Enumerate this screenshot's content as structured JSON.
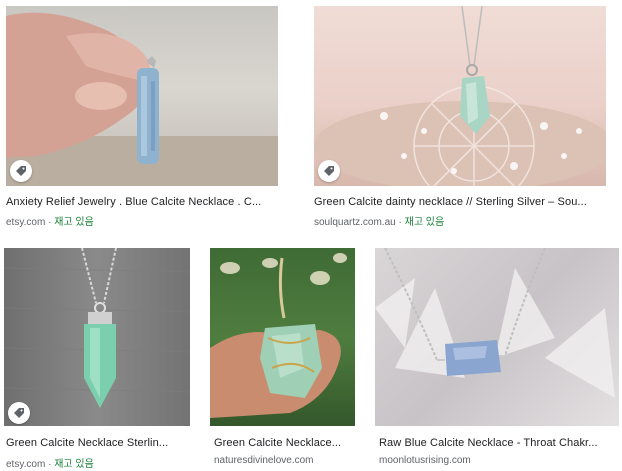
{
  "results": [
    {
      "title": "Anxiety Relief Jewelry . Blue Calcite Necklace . C...",
      "source": "etsy.com",
      "stock": "재고 있음",
      "has_tag": true
    },
    {
      "title": "Green Calcite dainty necklace // Sterling Silver – Sou...",
      "source": "soulquartz.com.au",
      "stock": "재고 있음",
      "has_tag": true
    },
    {
      "title": "Green Calcite Necklace Sterlin...",
      "source": "etsy.com",
      "stock": "재고 있음",
      "has_tag": true
    },
    {
      "title": "Green Calcite Necklace...",
      "source": "naturesdivinelove.com",
      "stock": "",
      "has_tag": false
    },
    {
      "title": "Raw Blue Calcite Necklace - Throat Chakr...",
      "source": "moonlotusrising.com",
      "stock": "",
      "has_tag": false
    }
  ],
  "separator": "·",
  "colors": {
    "title": "#202124",
    "source": "#5f6368",
    "stock": "#188038"
  }
}
